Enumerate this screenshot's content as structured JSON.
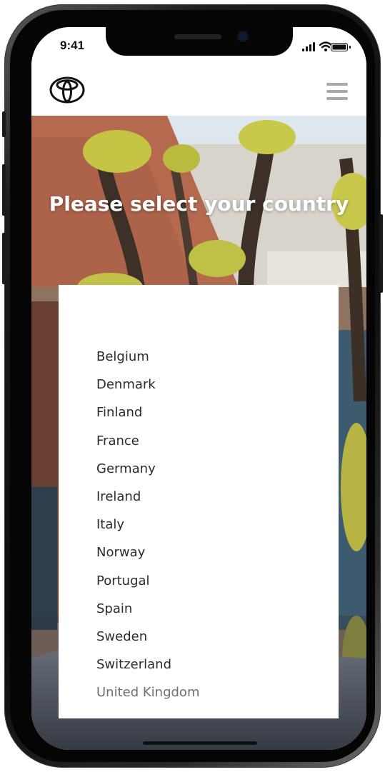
{
  "status_bar": {
    "time": "9:41"
  },
  "header": {
    "logo_icon": "toyota-logo-icon",
    "menu_icon": "hamburger-menu-icon"
  },
  "hero": {
    "title": "Please select your country"
  },
  "countries": [
    "Belgium",
    "Denmark",
    "Finland",
    "France",
    "Germany",
    "Ireland",
    "Italy",
    "Norway",
    "Portugal",
    "Spain",
    "Sweden",
    "Switzerland",
    "United Kingdom"
  ],
  "colors": {
    "menu_icon": "#a9a9a9",
    "text": "#2b2b2b",
    "muted_text": "#6f6f6f",
    "panel": "#ffffff"
  }
}
